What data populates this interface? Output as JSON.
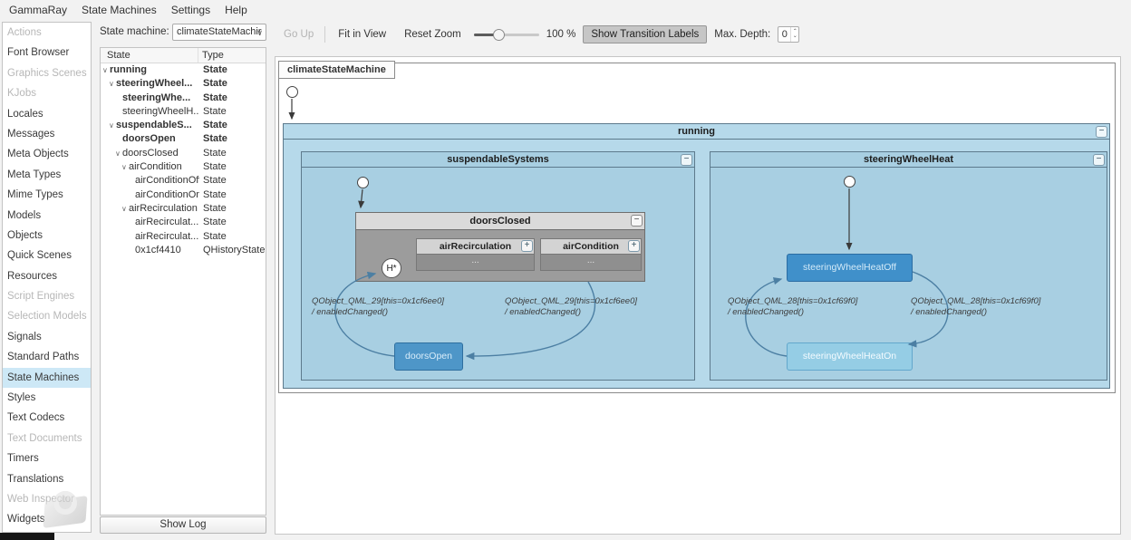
{
  "menubar": {
    "items": [
      "GammaRay",
      "State Machines",
      "Settings",
      "Help"
    ]
  },
  "sidebar": {
    "items": [
      {
        "label": "Actions",
        "enabled": false,
        "selected": false
      },
      {
        "label": "Font Browser",
        "enabled": true,
        "selected": false
      },
      {
        "label": "Graphics Scenes",
        "enabled": false,
        "selected": false
      },
      {
        "label": "KJobs",
        "enabled": false,
        "selected": false
      },
      {
        "label": "Locales",
        "enabled": true,
        "selected": false
      },
      {
        "label": "Messages",
        "enabled": true,
        "selected": false
      },
      {
        "label": "Meta Objects",
        "enabled": true,
        "selected": false
      },
      {
        "label": "Meta Types",
        "enabled": true,
        "selected": false
      },
      {
        "label": "Mime Types",
        "enabled": true,
        "selected": false
      },
      {
        "label": "Models",
        "enabled": true,
        "selected": false
      },
      {
        "label": "Objects",
        "enabled": true,
        "selected": false
      },
      {
        "label": "Quick Scenes",
        "enabled": true,
        "selected": false
      },
      {
        "label": "Resources",
        "enabled": true,
        "selected": false
      },
      {
        "label": "Script Engines",
        "enabled": false,
        "selected": false
      },
      {
        "label": "Selection Models",
        "enabled": false,
        "selected": false
      },
      {
        "label": "Signals",
        "enabled": true,
        "selected": false
      },
      {
        "label": "Standard Paths",
        "enabled": true,
        "selected": false
      },
      {
        "label": "State Machines",
        "enabled": true,
        "selected": true
      },
      {
        "label": "Styles",
        "enabled": true,
        "selected": false
      },
      {
        "label": "Text Codecs",
        "enabled": true,
        "selected": false
      },
      {
        "label": "Text Documents",
        "enabled": false,
        "selected": false
      },
      {
        "label": "Timers",
        "enabled": true,
        "selected": false
      },
      {
        "label": "Translations",
        "enabled": true,
        "selected": false
      },
      {
        "label": "Web Inspector",
        "enabled": false,
        "selected": false
      },
      {
        "label": "Widgets",
        "enabled": true,
        "selected": false
      }
    ]
  },
  "state_panel": {
    "machine_label": "State machine:",
    "machine_value": "climateStateMachir",
    "columns": [
      "State",
      "Type"
    ],
    "rows": [
      {
        "name": "running",
        "type": "State",
        "depth": 0,
        "bold": true,
        "expander": true
      },
      {
        "name": "steeringWheel...",
        "type": "State",
        "depth": 1,
        "bold": true,
        "expander": true
      },
      {
        "name": "steeringWhe...",
        "type": "State",
        "depth": 2,
        "bold": true,
        "expander": false
      },
      {
        "name": "steeringWheelH...",
        "type": "State",
        "depth": 2,
        "bold": false,
        "expander": false
      },
      {
        "name": "suspendableS...",
        "type": "State",
        "depth": 1,
        "bold": true,
        "expander": true
      },
      {
        "name": "doorsOpen",
        "type": "State",
        "depth": 2,
        "bold": true,
        "expander": false
      },
      {
        "name": "doorsClosed",
        "type": "State",
        "depth": 2,
        "bold": false,
        "expander": true
      },
      {
        "name": "airCondition",
        "type": "State",
        "depth": 3,
        "bold": false,
        "expander": true
      },
      {
        "name": "airConditionOff",
        "type": "State",
        "depth": 4,
        "bold": false,
        "expander": false
      },
      {
        "name": "airConditionOn",
        "type": "State",
        "depth": 4,
        "bold": false,
        "expander": false
      },
      {
        "name": "airRecirculation",
        "type": "State",
        "depth": 3,
        "bold": false,
        "expander": true
      },
      {
        "name": "airRecirculat...",
        "type": "State",
        "depth": 4,
        "bold": false,
        "expander": false
      },
      {
        "name": "airRecirculat...",
        "type": "State",
        "depth": 4,
        "bold": false,
        "expander": false
      },
      {
        "name": "0x1cf4410",
        "type": "QHistoryState",
        "depth": 4,
        "bold": false,
        "expander": false
      }
    ],
    "show_log_label": "Show Log"
  },
  "toolbar": {
    "go_up": "Go Up",
    "fit_in_view": "Fit in View",
    "reset_zoom": "Reset Zoom",
    "zoom_value": "100 %",
    "show_transition_labels": "Show Transition Labels",
    "max_depth_label": "Max. Depth:",
    "max_depth_value": "0"
  },
  "diagram": {
    "machine_title": "climateStateMachine",
    "running_label": "running",
    "suspendable_label": "suspendableSystems",
    "steering_label": "steeringWheelHeat",
    "doors_closed_label": "doorsClosed",
    "air_recirculation_label": "airRecirculation",
    "air_condition_label": "airCondition",
    "collapsed_content": "...",
    "history_label": "H*",
    "doors_open_label": "doorsOpen",
    "heat_off_label": "steeringWheelHeatOff",
    "heat_on_label": "steeringWheelHeatOn",
    "transitions": {
      "qml29": {
        "line1": "QObject_QML_29[this=0x1cf6ee0]",
        "line2": "/ enabledChanged()"
      },
      "qml28": {
        "line1": "QObject_QML_28[this=0x1cf69f0]",
        "line2": "/ enabledChanged()"
      }
    }
  },
  "icons": {
    "combo_arrow": "∨",
    "tree_expanded": "∨",
    "collapse": "−",
    "expand": "+",
    "spin_up": "⌃",
    "spin_down": "⌄"
  },
  "colors": {
    "selection_bg": "#cde8f6",
    "region_fill": "#b6d9ea",
    "inner_region_fill": "#a8cfe2",
    "active_state_fill": "#4e96c8",
    "light_state_fill": "#95cde5",
    "transition_stroke": "#4c7fa3"
  }
}
